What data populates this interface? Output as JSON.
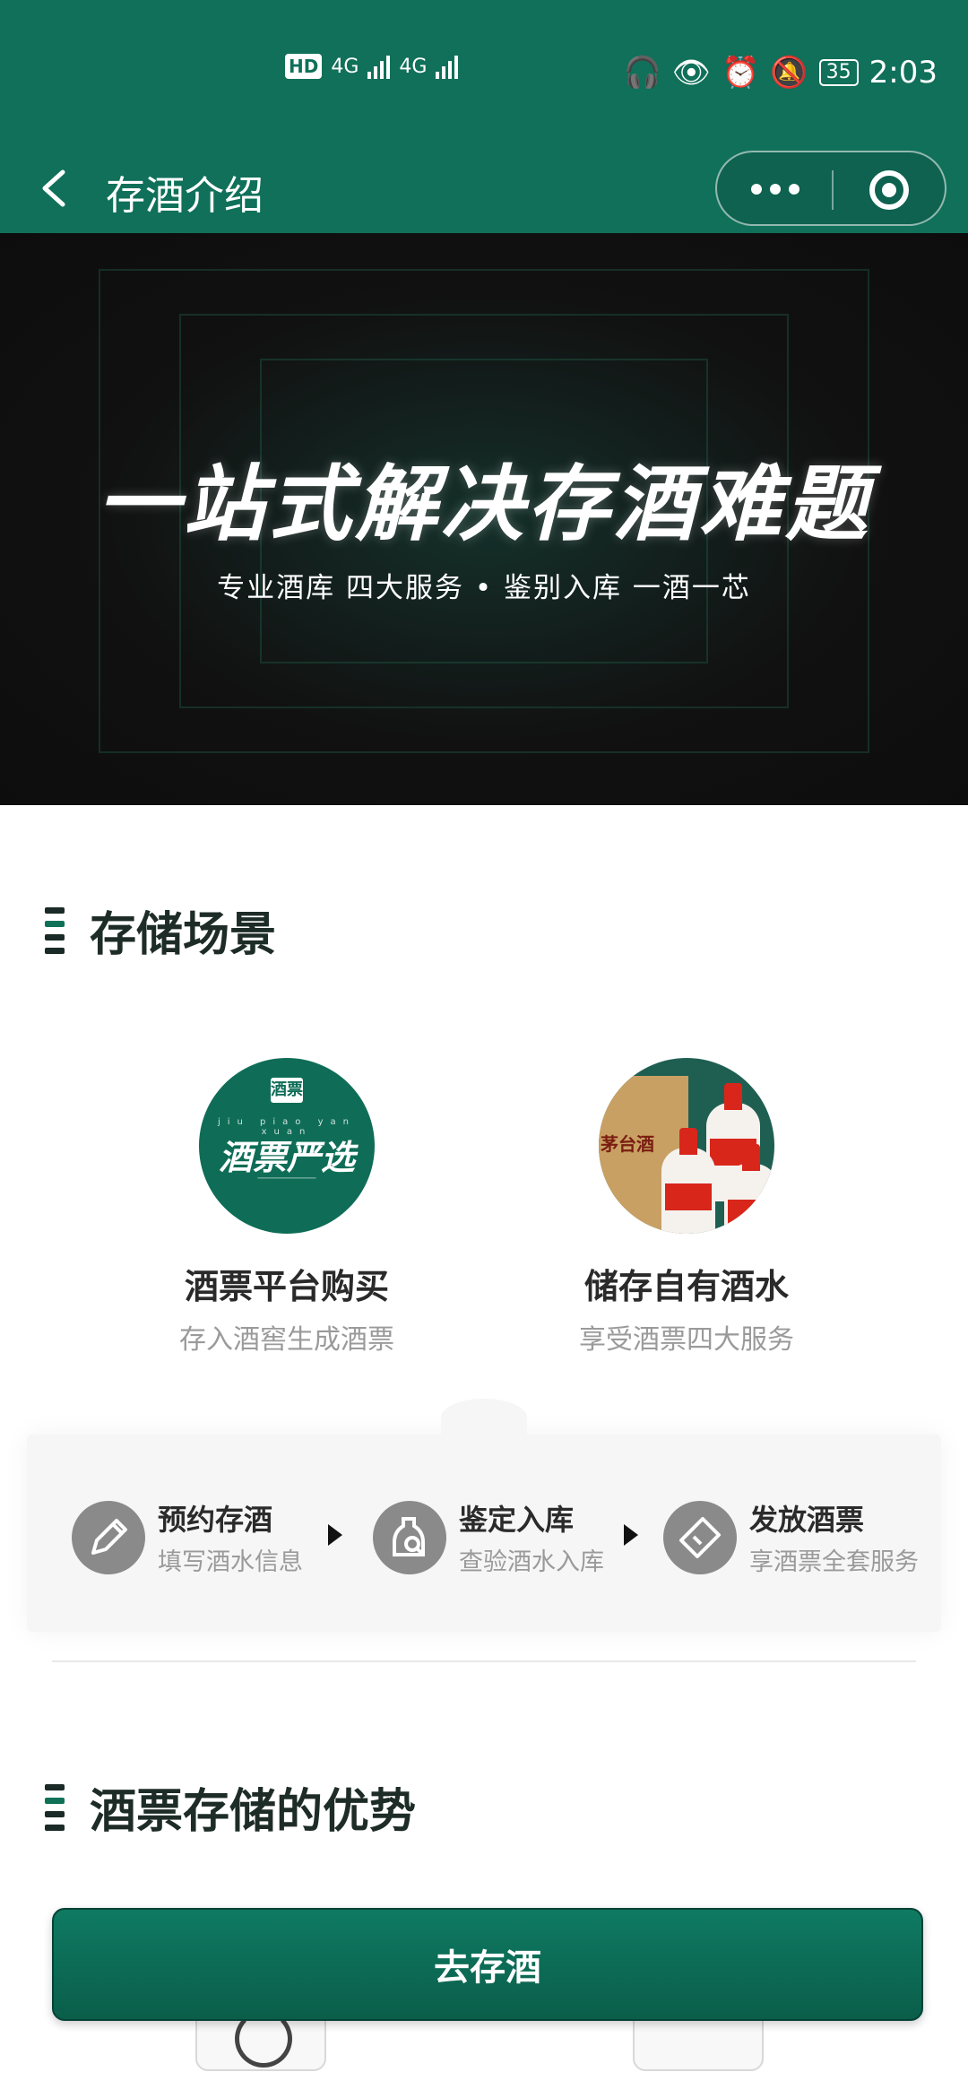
{
  "status_bar": {
    "hd": "HD",
    "net1": "4G",
    "net2": "4G",
    "battery": "35",
    "time": "2:03"
  },
  "nav": {
    "title": "存酒介绍"
  },
  "banner": {
    "title": "一站式解决存酒难题",
    "subtitle": "专业酒库 四大服务 • 鉴别入库 一酒一芯"
  },
  "storage_scenes": {
    "title": "存储场景",
    "items": [
      {
        "title": "酒票平台购买",
        "subtitle": "存入酒窖生成酒票",
        "logo_small": "酒票",
        "logo_pinyin": "jiu piao yan xuan",
        "logo_big": "酒票严选"
      },
      {
        "title": "储存自有酒水",
        "subtitle": "享受酒票四大服务",
        "box_text": "茅台酒"
      }
    ]
  },
  "process": {
    "steps": [
      {
        "title": "预约存酒",
        "subtitle": "填写酒水信息",
        "icon": "pencil-icon"
      },
      {
        "title": "鉴定入库",
        "subtitle": "查验酒水入库",
        "icon": "bottle-inspect-icon"
      },
      {
        "title": "发放酒票",
        "subtitle": "享酒票全套服务",
        "icon": "ticket-icon"
      }
    ]
  },
  "advantages": {
    "title": "酒票存储的优势"
  },
  "cta": {
    "label": "去存酒"
  },
  "colors": {
    "brand_green": "#10705a",
    "banner_bg": "#111111"
  }
}
